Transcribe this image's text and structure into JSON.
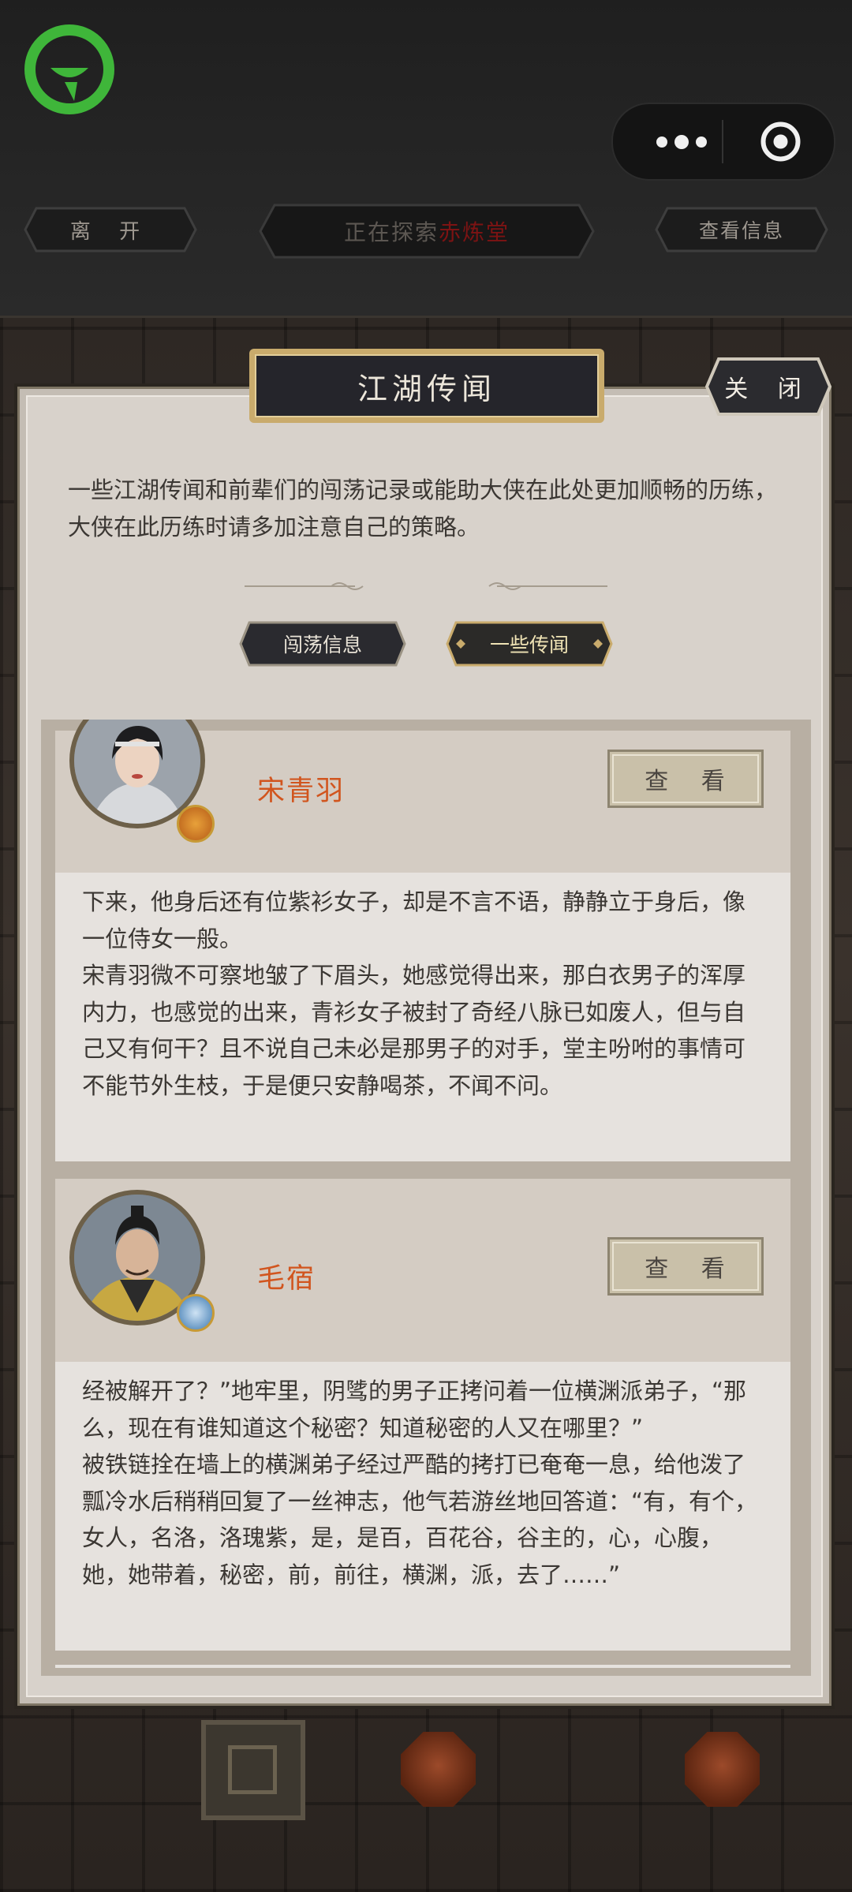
{
  "topbar": {
    "leave_label": "离 开",
    "explore_prefix": "正在探索",
    "explore_place": "赤炼堂",
    "info_label": "查看信息",
    "menu_icon": "more-dots-icon",
    "close_icon": "target-circle-icon"
  },
  "modal": {
    "title": "江湖传闻",
    "close_label": "关 闭",
    "intro": "一些江湖传闻和前辈们的闯荡记录或能助大侠在此处更加顺畅的历练，大侠在此历练时请多加注意自己的策略。",
    "tabs": [
      {
        "label": "闯荡信息",
        "active": false
      },
      {
        "label": "一些传闻",
        "active": true
      }
    ]
  },
  "rumors": [
    {
      "name": "宋青羽",
      "view_label": "查 看",
      "text": "下来，他身后还有位紫衫女子，却是不言不语，静静立于身后，像一位侍女一般。\n宋青羽微不可察地皱了下眉头，她感觉得出来，那白衣男子的浑厚内力，也感觉的出来，青衫女子被封了奇经八脉已如废人，但与自己又有何干？且不说自己未必是那男子的对手，堂主吩咐的事情可不能节外生枝，于是便只安静喝茶，不闻不问。"
    },
    {
      "name": "毛宿",
      "view_label": "查 看",
      "text": "经被解开了？”地牢里，阴骘的男子正拷问着一位横渊派弟子，“那么，现在有谁知道这个秘密？知道秘密的人又在哪里？”\n被铁链拴在墙上的横渊弟子经过严酷的拷打已奄奄一息，给他泼了瓢冷水后稍稍回复了一丝神志，他气若游丝地回答道：“有，有个，女人，名洛，洛瑰紫，是，是百，百花谷，谷主的，心，心腹，她，她带着，秘密，前，前往，横渊，派，去了……”"
    }
  ],
  "colors": {
    "accent_name": "#d1551e",
    "logo_green": "#3fb63a",
    "explore_place": "#7d1313"
  }
}
